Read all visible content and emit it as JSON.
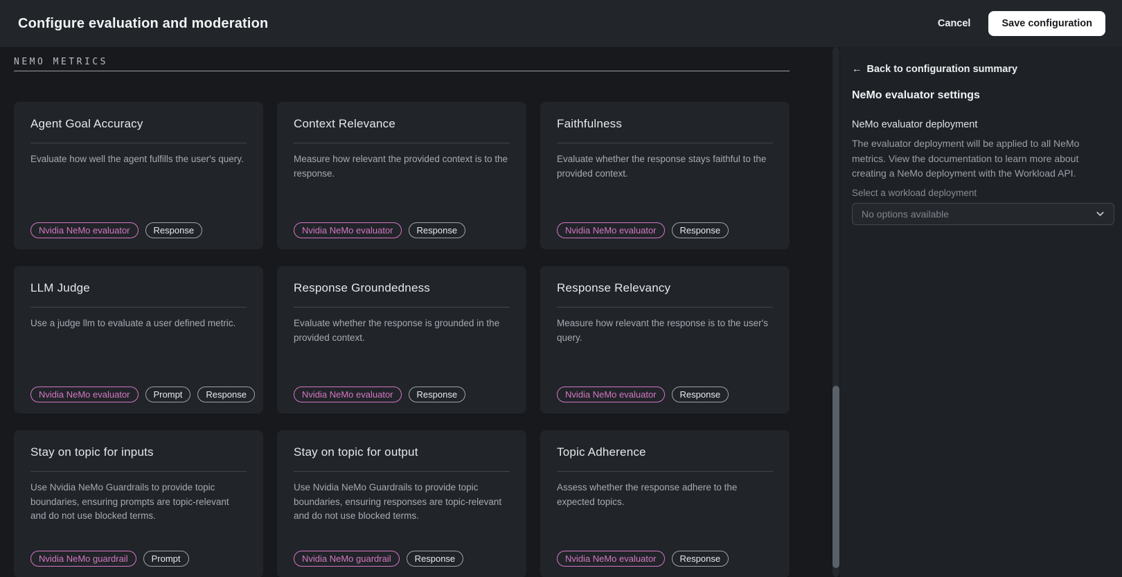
{
  "header": {
    "title": "Configure evaluation and moderation",
    "cancel_label": "Cancel",
    "save_label": "Save configuration"
  },
  "section": {
    "title": "NEMO METRICS"
  },
  "cards": [
    {
      "title": "Agent Goal Accuracy",
      "description": "Evaluate how well the agent fulfills the user's query.",
      "tags": [
        {
          "label": "Nvidia NeMo evaluator",
          "style": "pink"
        },
        {
          "label": "Response",
          "style": "default"
        }
      ]
    },
    {
      "title": "Context Relevance",
      "description": "Measure how relevant the provided context is to the response.",
      "tags": [
        {
          "label": "Nvidia NeMo evaluator",
          "style": "pink"
        },
        {
          "label": "Response",
          "style": "default"
        }
      ]
    },
    {
      "title": "Faithfulness",
      "description": "Evaluate whether the response stays faithful to the provided context.",
      "tags": [
        {
          "label": "Nvidia NeMo evaluator",
          "style": "pink"
        },
        {
          "label": "Response",
          "style": "default"
        }
      ]
    },
    {
      "title": "LLM Judge",
      "description": "Use a judge llm to evaluate a user defined metric.",
      "tags": [
        {
          "label": "Nvidia NeMo evaluator",
          "style": "pink"
        },
        {
          "label": "Prompt",
          "style": "default"
        },
        {
          "label": "Response",
          "style": "default"
        }
      ]
    },
    {
      "title": "Response Groundedness",
      "description": "Evaluate whether the response is grounded in the provided context.",
      "tags": [
        {
          "label": "Nvidia NeMo evaluator",
          "style": "pink"
        },
        {
          "label": "Response",
          "style": "default"
        }
      ]
    },
    {
      "title": "Response Relevancy",
      "description": "Measure how relevant the response is to the user's query.",
      "tags": [
        {
          "label": "Nvidia NeMo evaluator",
          "style": "pink"
        },
        {
          "label": "Response",
          "style": "default"
        }
      ]
    },
    {
      "title": "Stay on topic for inputs",
      "description": "Use Nvidia NeMo Guardrails to provide topic boundaries, ensuring prompts are topic-relevant and do not use blocked terms.",
      "tags": [
        {
          "label": "Nvidia NeMo guardrail",
          "style": "pink"
        },
        {
          "label": "Prompt",
          "style": "default"
        }
      ]
    },
    {
      "title": "Stay on topic for output",
      "description": "Use Nvidia NeMo Guardrails to provide topic boundaries, ensuring responses are topic-relevant and do not use blocked terms.",
      "tags": [
        {
          "label": "Nvidia NeMo guardrail",
          "style": "pink"
        },
        {
          "label": "Response",
          "style": "default"
        }
      ]
    },
    {
      "title": "Topic Adherence",
      "description": "Assess whether the response adhere to the expected topics.",
      "tags": [
        {
          "label": "Nvidia NeMo evaluator",
          "style": "pink"
        },
        {
          "label": "Response",
          "style": "default"
        }
      ]
    }
  ],
  "sidebar": {
    "back_arrow": "←",
    "back_label": "Back to configuration summary",
    "title": "NeMo evaluator settings",
    "subsection_title": "NeMo evaluator deployment",
    "description": "The evaluator deployment will be applied to all NeMo metrics. View the documentation to learn more about creating a NeMo deployment with the Workload API.",
    "select_label": "Select a workload deployment",
    "select_value": "No options available"
  },
  "colors": {
    "accent_pink": "#d478c2",
    "header_bg": "#222529",
    "page_bg": "#17191d",
    "card_bg": "#212429",
    "sidebar_bg": "#1e2126",
    "save_button_bg": "#ffffff"
  }
}
